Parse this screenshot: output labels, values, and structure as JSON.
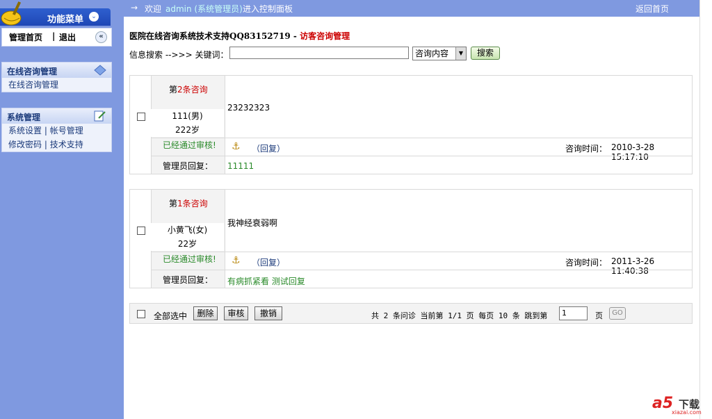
{
  "sidebar": {
    "title": "功能菜单",
    "links": {
      "home": "管理首页",
      "sep": "|",
      "logout": "退出"
    },
    "sections": [
      {
        "title": "在线咨询管理",
        "items": [
          "在线咨询管理"
        ]
      },
      {
        "title": "系统管理",
        "rows": [
          [
            "系统设置",
            "帐号管理"
          ],
          [
            "修改密码",
            "技术支持"
          ]
        ]
      }
    ]
  },
  "topbar": {
    "arrow": "→",
    "welcome": "欢迎",
    "user": "admin (系统管理员)",
    "enter": "进入控制面板",
    "back": "返回首页"
  },
  "page": {
    "title_prefix": "医院在线咨询系统技术支持QQ83152719 -",
    "title_highlight": "访客咨询管理"
  },
  "search": {
    "label": "信息搜索 -->>> 关键词：",
    "value": "",
    "select": "咨询内容",
    "button": "搜索"
  },
  "entries": [
    {
      "num_prefix": "第",
      "num": "2",
      "num_suffix": "条咨询",
      "name": "111(男)",
      "age": "222岁",
      "status": "已经通过审核!",
      "content": "23232323",
      "reply_link": "（回复）",
      "time_label": "咨询时间：",
      "time": "2010-3-28 15:17:10",
      "admin_label": "管理员回复：",
      "admin_reply": "11111"
    },
    {
      "num_prefix": "第",
      "num": "1",
      "num_suffix": "条咨询",
      "name": "小黄飞(女)",
      "age": "22岁",
      "status": "已经通过审核!",
      "content": "我神经衰弱啊",
      "reply_link": "（回复）",
      "time_label": "咨询时间：",
      "time": "2011-3-26 11:40:38",
      "admin_label": "管理员回复：",
      "admin_reply": "有病抓紧看 测试回复"
    }
  ],
  "footer": {
    "select_all": "全部选中",
    "delete": "删除",
    "approve": "审核",
    "revoke": "撤销",
    "pager": "共 2 条问诊 当前第 1/1 页 每页 10 条 跳到第",
    "page_value": "1",
    "page_unit": "页",
    "go": "GO"
  },
  "watermark": {
    "logo": "a5",
    "text": "下载",
    "site": "xiazai.com"
  },
  "colors": {
    "sidebar_bg": "#7f99e0",
    "header_blue": "#2f5fcf",
    "highlight_red": "#cc0000",
    "status_green": "#2a8a2a"
  }
}
